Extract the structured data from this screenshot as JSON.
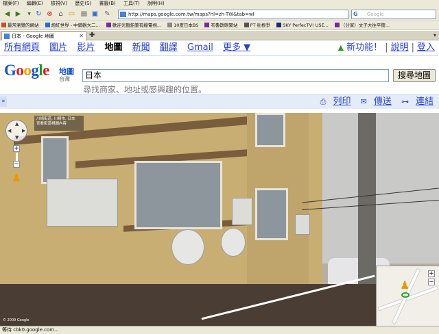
{
  "browser": {
    "menu": [
      "檔案(F)",
      "編輯(E)",
      "檢視(V)",
      "歷史(S)",
      "書籤(B)",
      "工具(T)",
      "說明(H)"
    ],
    "url": "http://maps.google.com.tw/maps?hl=zh-TW&tab=wl",
    "search_placeholder": "Google",
    "bookmarks": [
      "最常瀏覽的網站",
      "炮紅世界 - 中鋪觀大二...",
      "歡迎光臨鉛筆有線電視...",
      "10度日本BS",
      "布魯斯眼聚站",
      "PT 壯根爭",
      "SKY PerfecTV! USE...",
      "（分家）文子大往平衝..."
    ],
    "tab_title": "日本 - Google 地圖",
    "status": "等待 cbk0.google.com..."
  },
  "gnav": {
    "links": [
      "所有網頁",
      "圖片",
      "影片"
    ],
    "active": "地圖",
    "links2": [
      "新聞",
      "翻譯",
      "Gmail",
      "更多 ▼"
    ],
    "new_feature": "新功能！",
    "help": "說明",
    "login": "登入"
  },
  "header": {
    "logo_sub": "地圖",
    "logo_region": "台灣",
    "search_value": "日本",
    "search_button": "搜尋地圖",
    "hint": "尋找商家、地址或感興趣的位置。"
  },
  "toolbar": {
    "print": "列印",
    "send": "傳送",
    "link": "連結"
  },
  "streetview": {
    "label_line1": "川崎街道, 川崎市, 日本",
    "label_line2": "查看街道視圖內容",
    "copyright": "© 2009 Google"
  },
  "colors": {
    "link": "#2a44c8",
    "new": "#dd0000",
    "toolbar_bg": "#e5ecf9"
  }
}
